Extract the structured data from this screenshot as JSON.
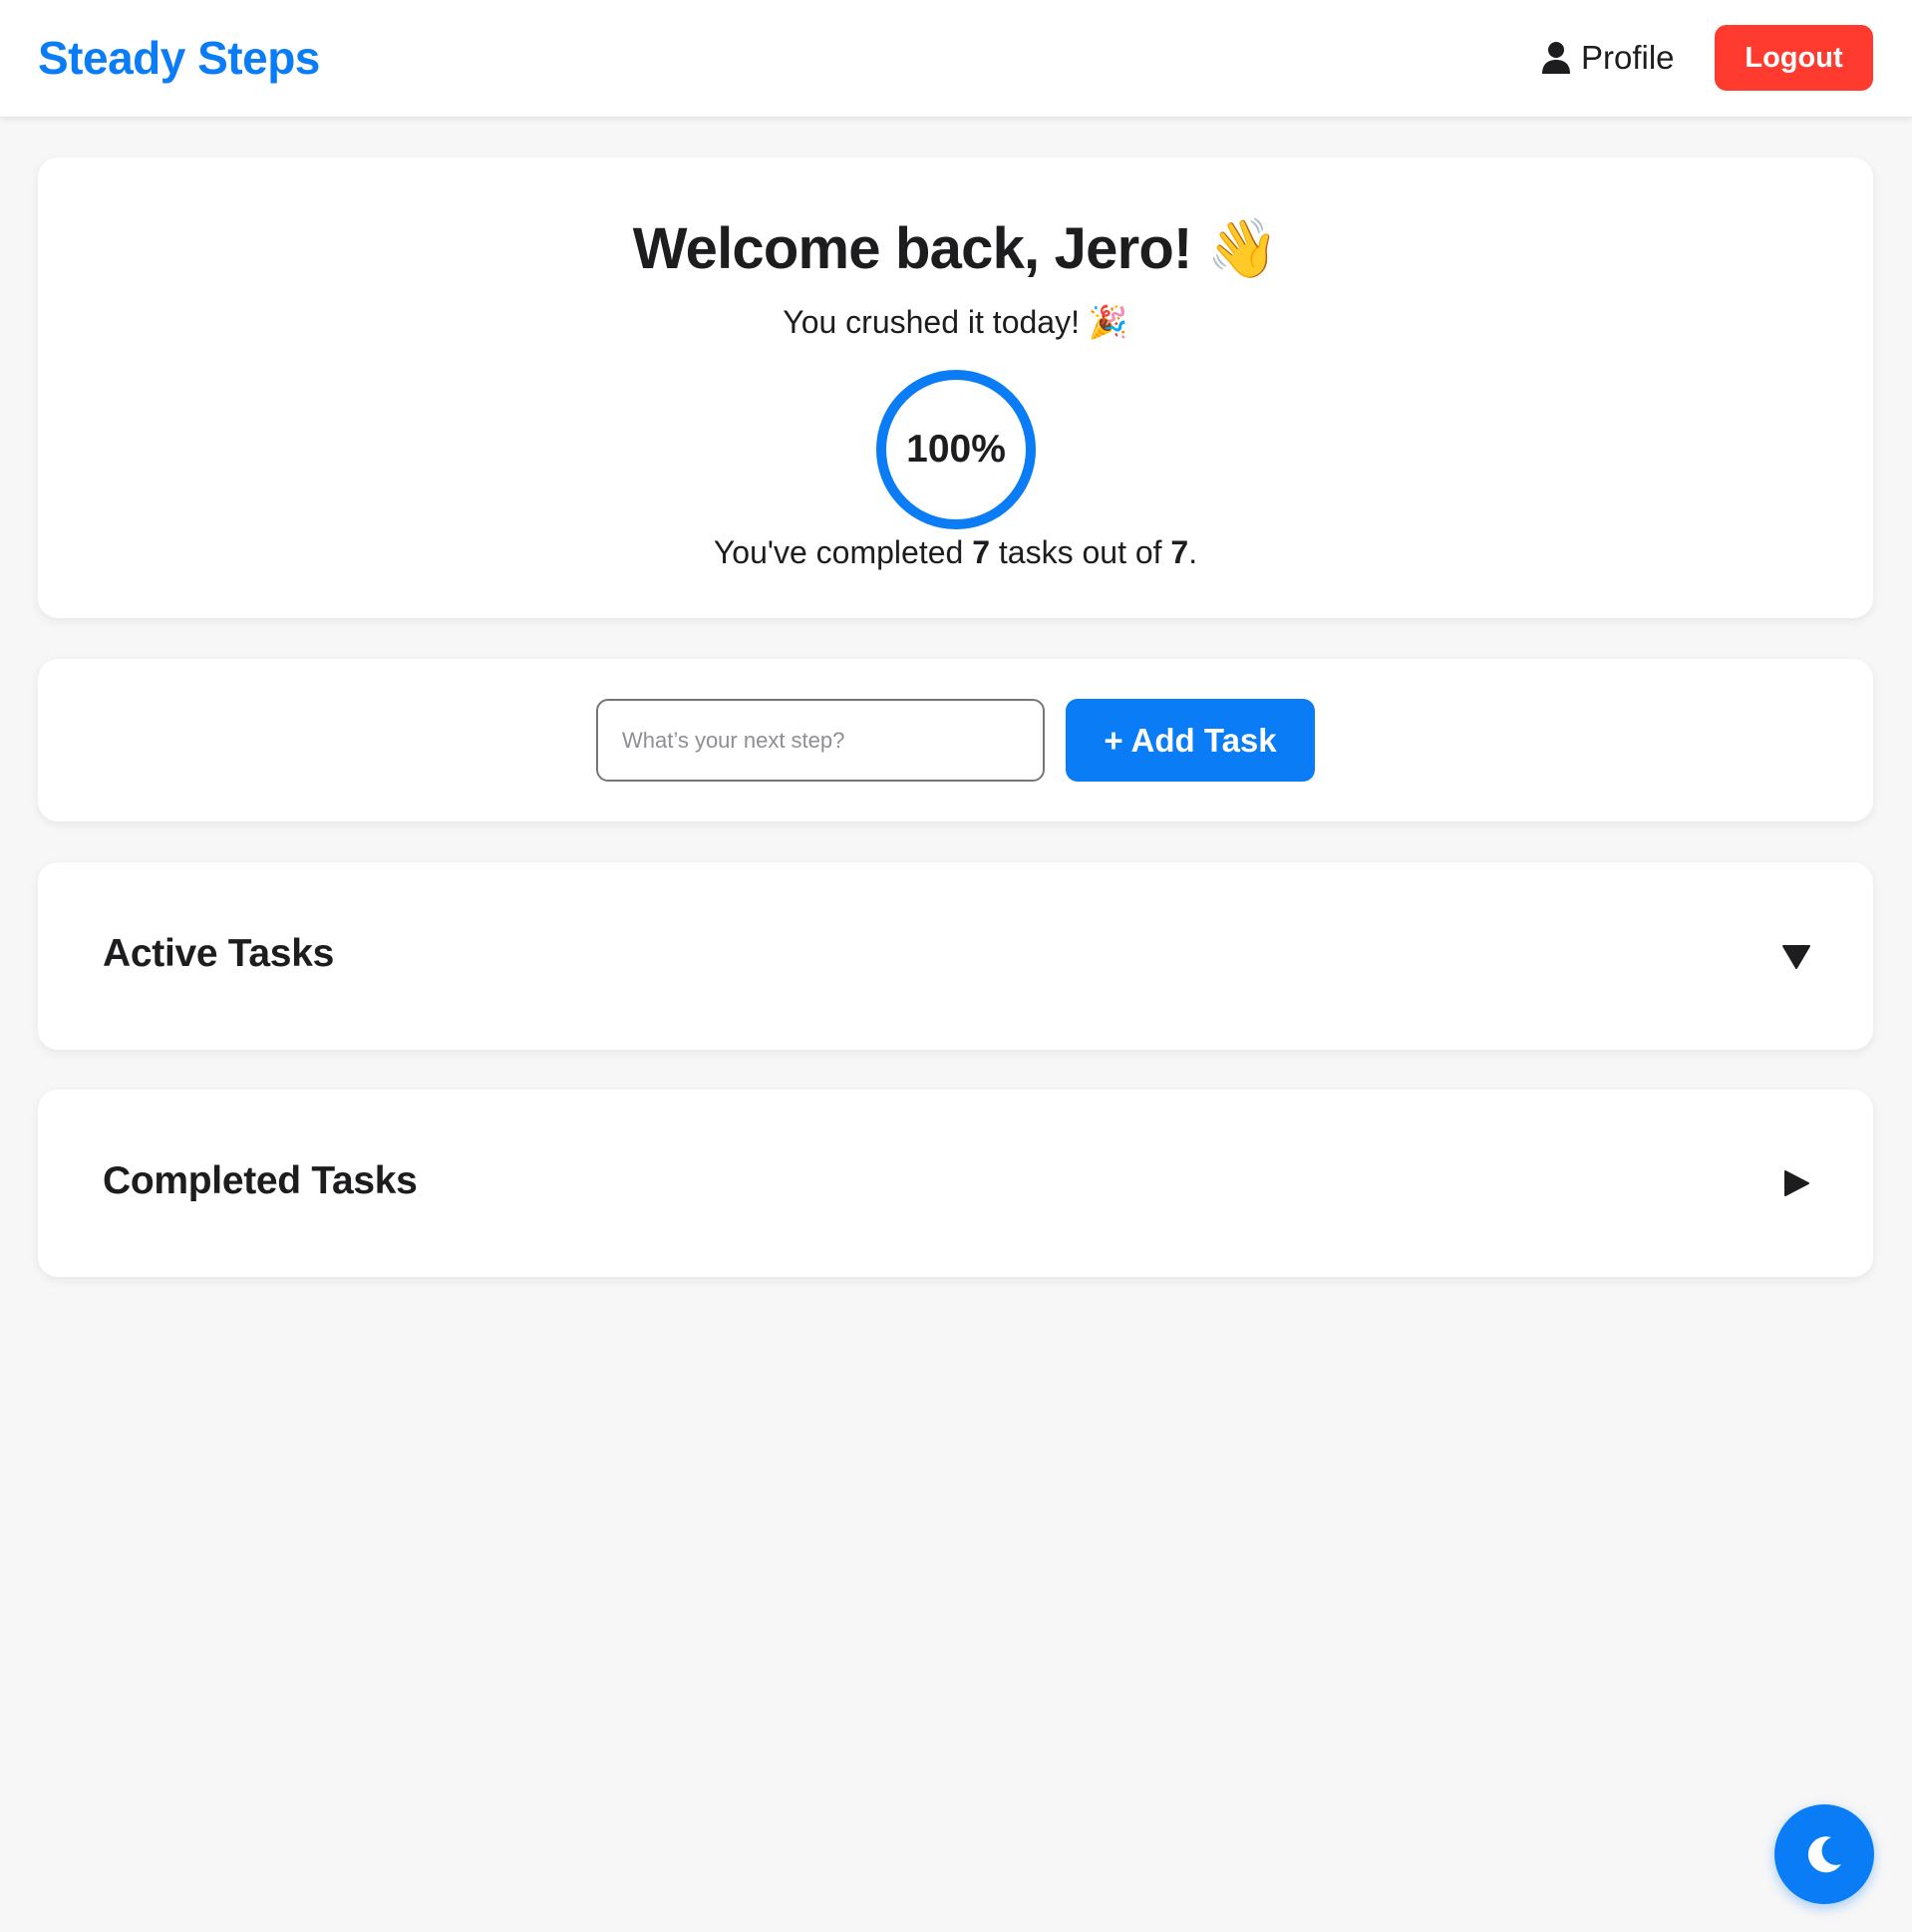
{
  "header": {
    "brand": "Steady Steps",
    "profile_label": "Profile",
    "logout_label": "Logout"
  },
  "welcome": {
    "title": "Welcome back, Jero! 👋",
    "subtitle": "You crushed it today! 🎉",
    "progress_percent_label": "100%",
    "progress_fraction": 1.0,
    "completed_prefix": "You've completed ",
    "completed_count": "7",
    "completed_middle": " tasks out of ",
    "total_count": "7",
    "completed_suffix": "."
  },
  "add_task": {
    "placeholder": "What’s your next step?",
    "value": "",
    "button_label": "+ Add Task"
  },
  "sections": {
    "active": {
      "title": "Active Tasks",
      "state": "expanded"
    },
    "completed": {
      "title": "Completed Tasks",
      "state": "collapsed"
    }
  },
  "colors": {
    "accent": "#0a7cf5",
    "danger": "#ff3b30",
    "background": "#f7f7f7",
    "card": "#ffffff",
    "text": "#1d1d1f"
  },
  "icons": {
    "profile": "user-icon",
    "active_toggle": "caret-down-icon",
    "completed_toggle": "caret-right-icon",
    "theme": "moon-icon"
  }
}
